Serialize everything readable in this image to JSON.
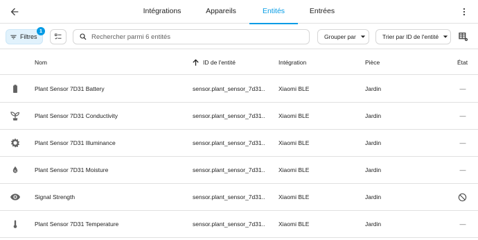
{
  "topbar": {
    "tabs": [
      {
        "label": "Intégrations",
        "active": false
      },
      {
        "label": "Appareils",
        "active": false
      },
      {
        "label": "Entités",
        "active": true
      },
      {
        "label": "Entrées",
        "active": false
      }
    ],
    "back_icon": "arrow-left-icon",
    "menu_icon": "dots-vertical-icon"
  },
  "toolbar": {
    "filters_label": "Filtres",
    "filters_count": "1",
    "search_placeholder": "Rechercher parmi 6 entités",
    "group_label": "Grouper par",
    "sort_label": "Trier par ID de l'entité"
  },
  "table": {
    "columns": {
      "name": "Nom",
      "entity_id": "ID de l'entité",
      "integration": "Intégration",
      "area": "Pièce",
      "state": "État"
    },
    "rows": [
      {
        "icon": "battery-icon",
        "name": "Plant Sensor 7D31 Battery",
        "entity_id": "sensor.plant_sensor_7d31...",
        "integration": "Xiaomi BLE",
        "area": "Jardin",
        "state": "—"
      },
      {
        "icon": "sprout-icon",
        "name": "Plant Sensor 7D31 Conductivity",
        "entity_id": "sensor.plant_sensor_7d31...",
        "integration": "Xiaomi BLE",
        "area": "Jardin",
        "state": "—"
      },
      {
        "icon": "sun-icon",
        "name": "Plant Sensor 7D31 Illuminance",
        "entity_id": "sensor.plant_sensor_7d31...",
        "integration": "Xiaomi BLE",
        "area": "Jardin",
        "state": "—"
      },
      {
        "icon": "water-percent-icon",
        "name": "Plant Sensor 7D31 Moisture",
        "entity_id": "sensor.plant_sensor_7d31...",
        "integration": "Xiaomi BLE",
        "area": "Jardin",
        "state": "—"
      },
      {
        "icon": "eye-icon",
        "name": "Signal Strength",
        "entity_id": "sensor.plant_sensor_7d31...",
        "integration": "Xiaomi BLE",
        "area": "Jardin",
        "state": "",
        "state_icon": "cancel-icon"
      },
      {
        "icon": "thermometer-icon",
        "name": "Plant Sensor 7D31 Temperature",
        "entity_id": "sensor.plant_sensor_7d31...",
        "integration": "Xiaomi BLE",
        "area": "Jardin",
        "state": "—"
      }
    ]
  },
  "colors": {
    "accent": "#039be5",
    "icon": "#616161",
    "divider": "#e0e0e0"
  }
}
